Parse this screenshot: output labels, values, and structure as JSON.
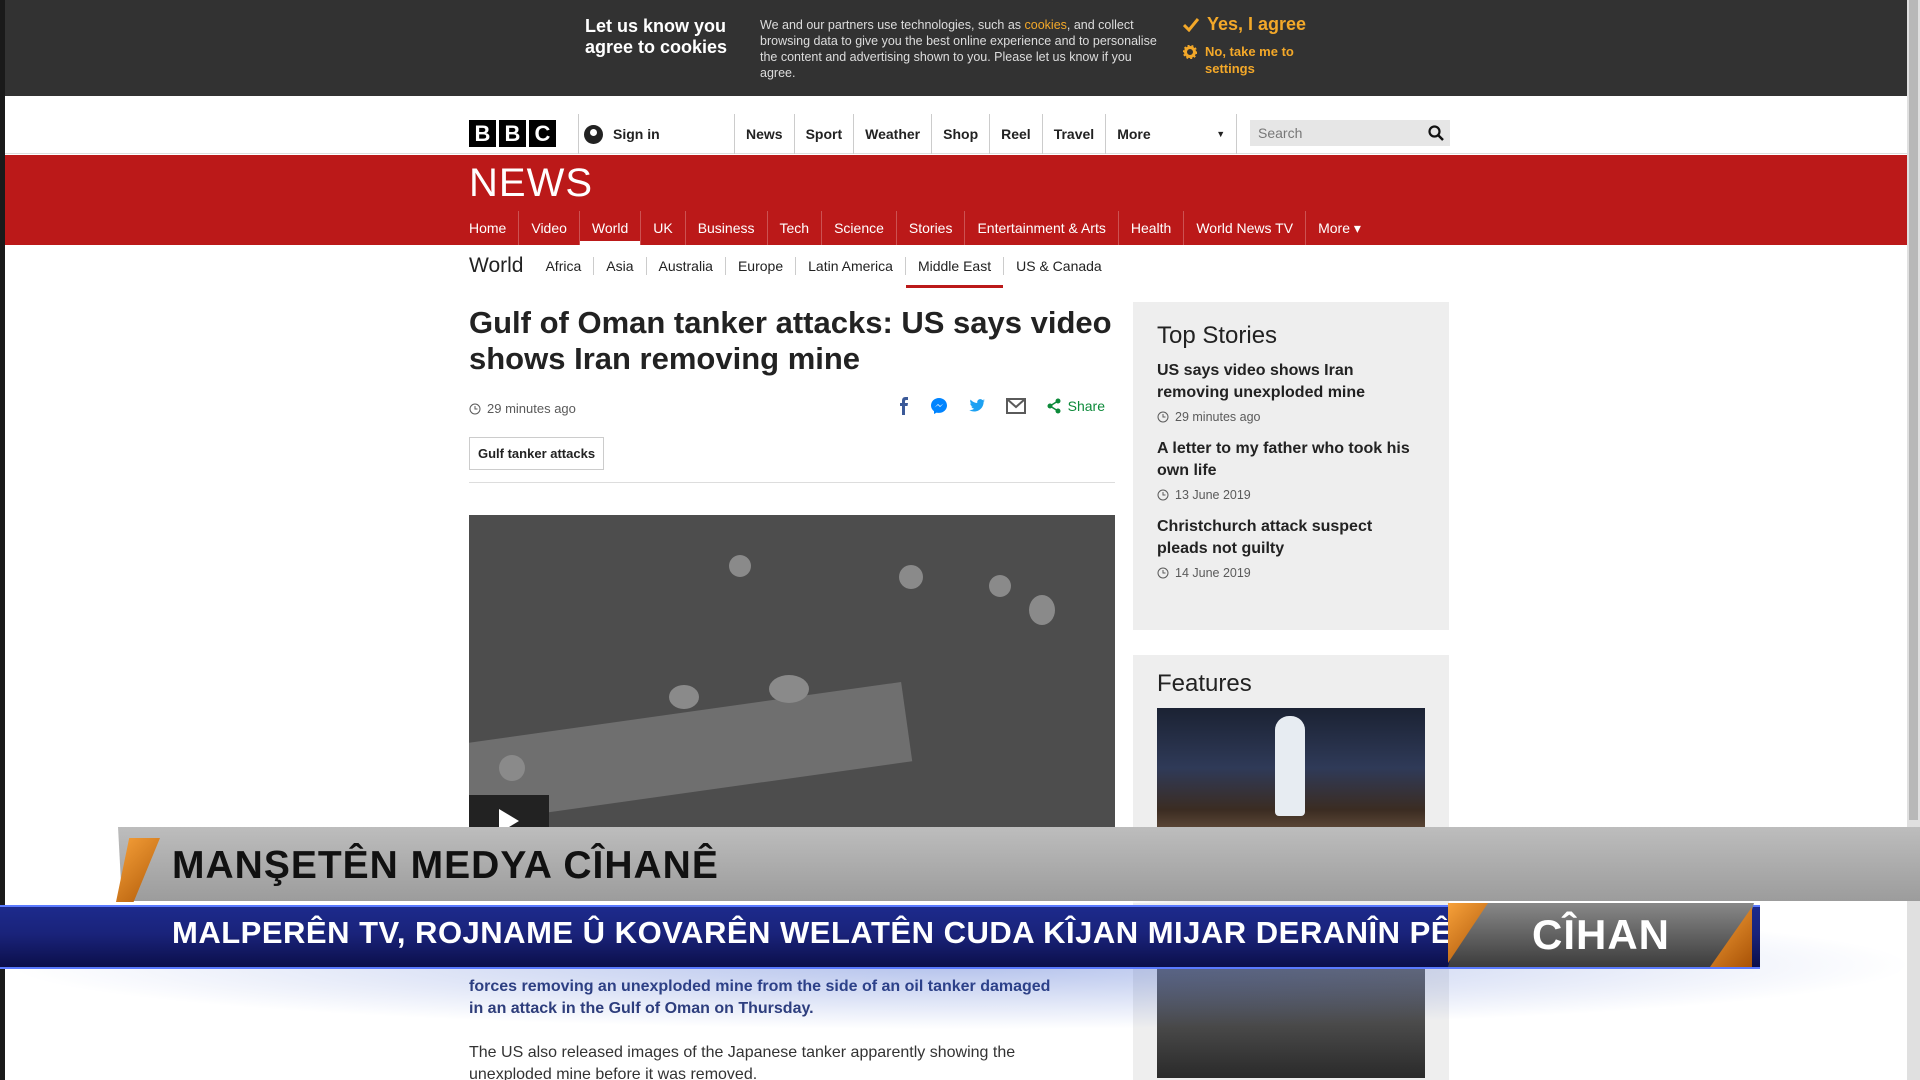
{
  "cookie_banner": {
    "title": "Let us know you agree to cookies",
    "body_before_link": "We and our partners use technologies, such as ",
    "body_link": "cookies",
    "body_after_link": ", and collect browsing data to give you the best online experience and to personalise the content and advertising shown to you. Please let us know if you agree.",
    "agree_label": "Yes, I agree",
    "settings_label": "No, take me to settings",
    "accent_color": "#f3a829"
  },
  "global_nav": {
    "logo_letters": [
      "B",
      "B",
      "C"
    ],
    "signin_label": "Sign in",
    "items": [
      "News",
      "Sport",
      "Weather",
      "Shop",
      "Reel",
      "Travel"
    ],
    "more_label": "More",
    "search_placeholder": "Search"
  },
  "masthead": {
    "logo_text": "NEWS",
    "brand_color": "#bb1919",
    "nav": [
      {
        "label": "Home",
        "active": false
      },
      {
        "label": "Video",
        "active": false
      },
      {
        "label": "World",
        "active": true
      },
      {
        "label": "UK",
        "active": false
      },
      {
        "label": "Business",
        "active": false
      },
      {
        "label": "Tech",
        "active": false
      },
      {
        "label": "Science",
        "active": false
      },
      {
        "label": "Stories",
        "active": false
      },
      {
        "label": "Entertainment & Arts",
        "active": false
      },
      {
        "label": "Health",
        "active": false
      },
      {
        "label": "World News TV",
        "active": false
      },
      {
        "label": "More ▾",
        "active": false
      }
    ]
  },
  "subnav": {
    "section": "World",
    "items": [
      {
        "label": "Africa",
        "active": false
      },
      {
        "label": "Asia",
        "active": false
      },
      {
        "label": "Australia",
        "active": false
      },
      {
        "label": "Europe",
        "active": false
      },
      {
        "label": "Latin America",
        "active": false
      },
      {
        "label": "Middle East",
        "active": true
      },
      {
        "label": "US & Canada",
        "active": false
      }
    ]
  },
  "article": {
    "headline": "Gulf of Oman tanker attacks: US says video shows Iran removing mine",
    "timestamp": "29 minutes ago",
    "share_label": "Share",
    "tag": "Gulf tanker attacks",
    "lead": "forces removing an unexploded mine from the side of an oil tanker damaged in an attack in the Gulf of Oman on Thursday.",
    "paragraph": "The US also released images of the Japanese tanker apparently showing the unexploded mine before it was removed."
  },
  "sidebar": {
    "top_stories_title": "Top Stories",
    "stories": [
      {
        "title": "US says video shows Iran removing unexploded mine",
        "time": "29 minutes ago"
      },
      {
        "title": "A letter to my father who took his own life",
        "time": "13 June 2019"
      },
      {
        "title": "Christchurch attack suspect pleads not guilty",
        "time": "14 June 2019"
      }
    ],
    "features_title": "Features"
  },
  "tv_overlay": {
    "title": "MANŞETÊN MEDYA CÎHANÊ",
    "subtitle": "MALPERÊN TV, ROJNAME Û KOVARÊN WELATÊN CUDA KÎJAN MIJAR DERANÎN PÊŞ?",
    "badge": "CÎHAN",
    "accent_color": "#f7a13a",
    "bar_color": "#1a237a"
  }
}
